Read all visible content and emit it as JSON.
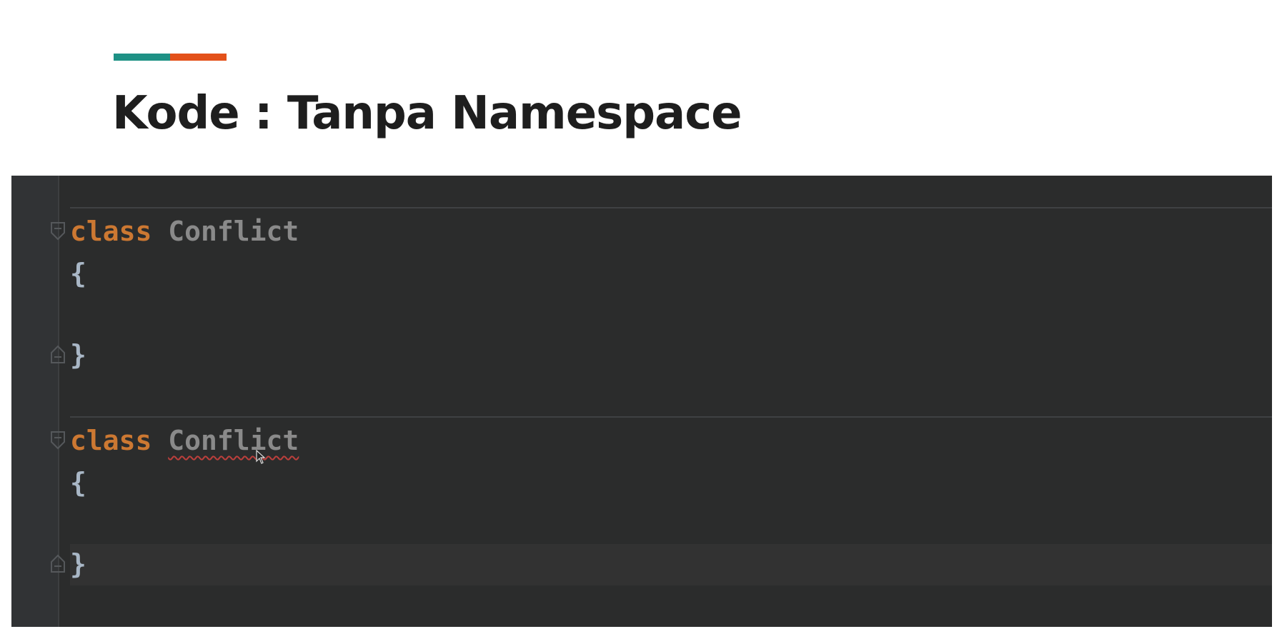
{
  "slide": {
    "title": "Kode : Tanpa Namespace",
    "accent_colors": [
      "#1e9185",
      "#e3511a"
    ]
  },
  "editor": {
    "background": "#2b2c2c",
    "gutter_background": "#313335",
    "keyword_color": "#cc7832",
    "class_name_color": "#8a8a8a",
    "error_underline_color": "#bc3f3c",
    "blocks": [
      {
        "keyword": "class",
        "class_name": "Conflict",
        "open_brace": "{",
        "close_brace": "}",
        "has_error": false
      },
      {
        "keyword": "class",
        "class_name": "Conflict",
        "open_brace": "{",
        "close_brace": "}",
        "has_error": true
      }
    ],
    "icons": {
      "fold_start": "fold-collapse-icon",
      "fold_end": "fold-end-icon",
      "cursor": "mouse-pointer-icon"
    }
  }
}
